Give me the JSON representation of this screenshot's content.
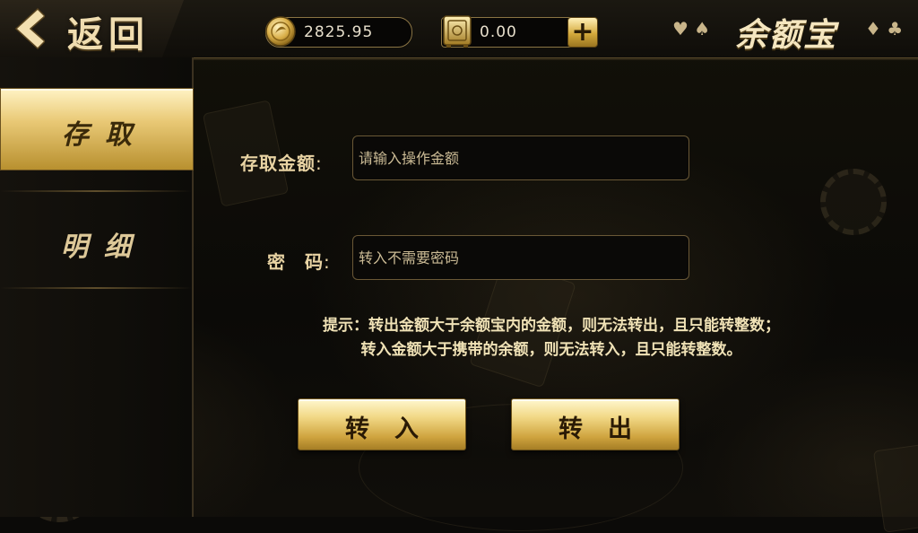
{
  "header": {
    "back_label": "返回",
    "coin_balance": "2825.95",
    "safe_balance": "0.00",
    "title": "余额宝",
    "suits_left": "♥ ♠",
    "suits_right": "♦ ♣"
  },
  "sidebar": {
    "items": [
      {
        "label": "存取",
        "active": true
      },
      {
        "label": "明细",
        "active": false
      }
    ]
  },
  "form": {
    "amount_label": "存取金额",
    "amount_placeholder": "请输入操作金额",
    "password_label": "密　码",
    "password_placeholder": "转入不需要密码",
    "colon": ":"
  },
  "hint": {
    "line1": "提示：转出金额大于余额宝内的金额，则无法转出，且只能转整数；",
    "line2": "转入金额大于携带的余额，则无法转入，且只能转整数。"
  },
  "buttons": {
    "transfer_in": "转入",
    "transfer_out": "转出"
  },
  "icons": {
    "back": "chevron-left-icon",
    "coin": "coin-icon",
    "safe": "safe-icon",
    "plus": "plus-icon"
  },
  "colors": {
    "gold_accent": "#e9c976",
    "background": "#0b0a08"
  }
}
